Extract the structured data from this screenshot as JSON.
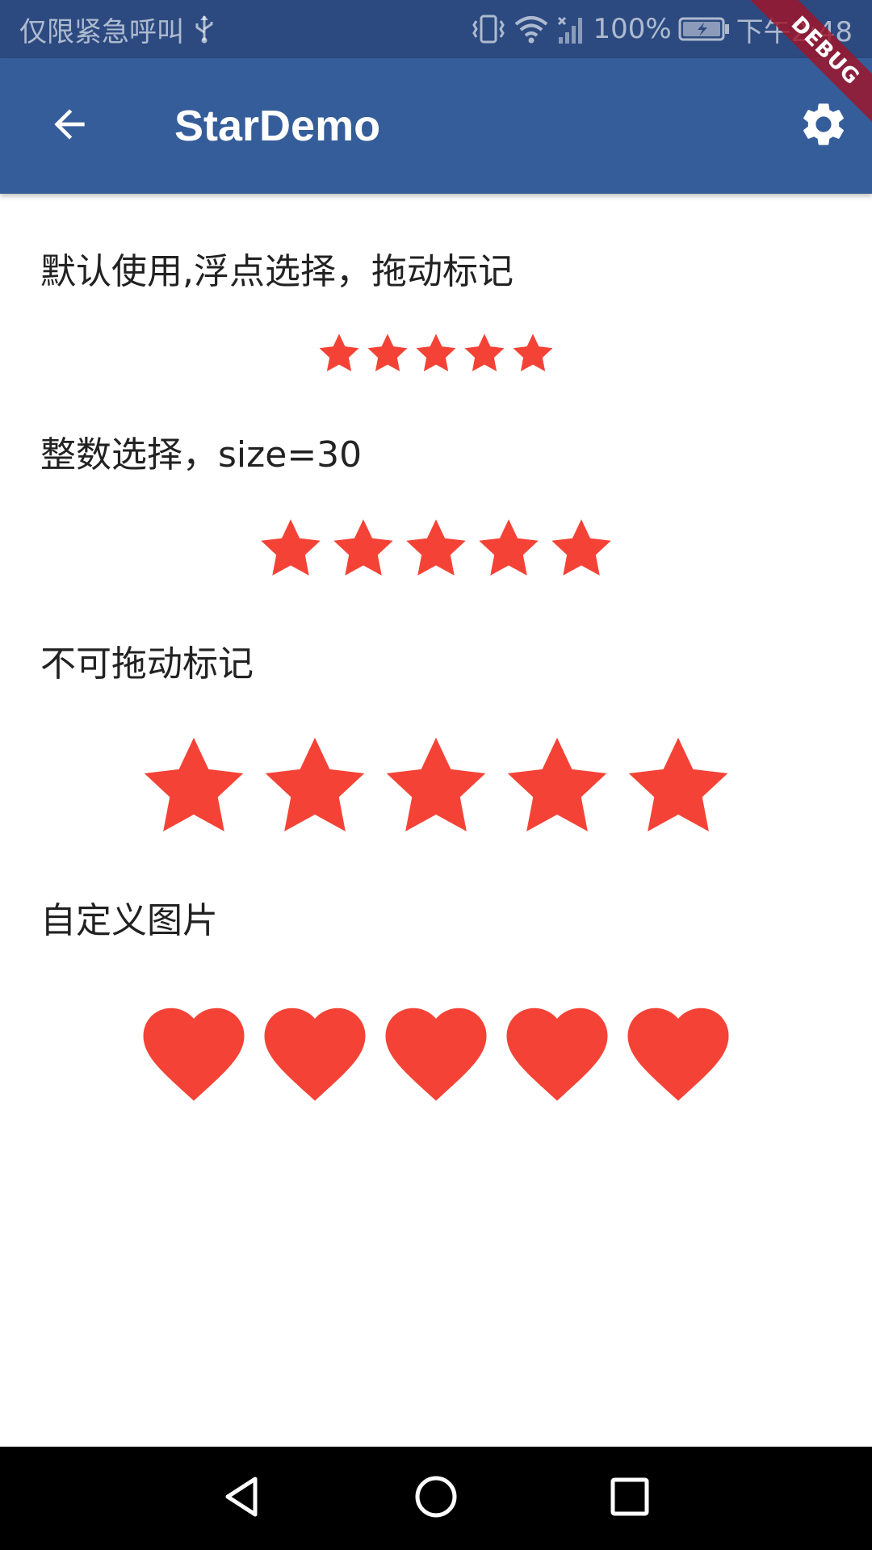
{
  "status_bar": {
    "carrier_text": "仅限紧急呼叫",
    "battery_text": "100%",
    "time_text": "下午2:48",
    "icons": [
      "usb-icon",
      "vibrate-icon",
      "wifi-icon",
      "signal-off-icon",
      "battery-charging-icon"
    ]
  },
  "app_bar": {
    "title": "StarDemo",
    "back_icon": "arrow-back-icon",
    "settings_icon": "gear-icon",
    "background_color": "#355d9a"
  },
  "debug_banner": {
    "label": "DEBUG"
  },
  "sections": [
    {
      "label": "默认使用,浮点选择，拖动标记",
      "icon": "star-icon",
      "count": 5
    },
    {
      "label": "整数选择，size=30",
      "icon": "star-icon",
      "count": 5
    },
    {
      "label": "不可拖动标记",
      "icon": "star-icon",
      "count": 5
    },
    {
      "label": "自定义图片",
      "icon": "heart-icon",
      "count": 5
    }
  ],
  "accent_color": "#f44336",
  "nav_bar": {
    "icons": [
      "nav-back-icon",
      "nav-home-icon",
      "nav-recents-icon"
    ]
  }
}
